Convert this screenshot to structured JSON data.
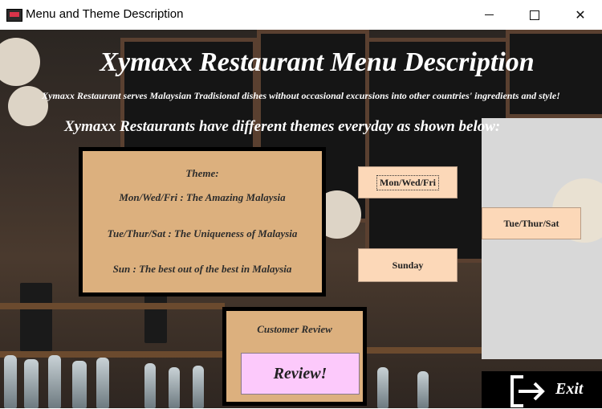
{
  "window": {
    "title": "Menu and Theme Description",
    "minimize_icon": "minimize-icon",
    "maximize_icon": "maximize-icon",
    "close_icon": "close-icon"
  },
  "header": {
    "title": "Xymaxx Restaurant Menu Description",
    "subtitle": "Xymaxx Restaurant serves Malaysian Tradisional dishes without occasional excursions into other countries' ingredients and style!",
    "themes_intro": "Xymaxx Restaurants have different themes everyday as shown below:"
  },
  "themes": {
    "heading": "Theme:",
    "items": [
      "Mon/Wed/Fri : The Amazing Malaysia",
      "Tue/Thur/Sat : The Uniqueness of Malaysia",
      "Sun : The best out of the best in Malaysia"
    ]
  },
  "day_buttons": {
    "mon_wed_fri": "Mon/Wed/Fri",
    "tue_thur_sat": "Tue/Thur/Sat",
    "sunday": "Sunday"
  },
  "review": {
    "label": "Customer Review",
    "button": "Review!"
  },
  "exit": {
    "label": "Exit",
    "icon": "exit-arrow-icon"
  },
  "colors": {
    "panel": "#dcb07e",
    "day_button": "#fcd8b8",
    "review_button": "#fcc9fb",
    "exit_bg": "#000000"
  }
}
